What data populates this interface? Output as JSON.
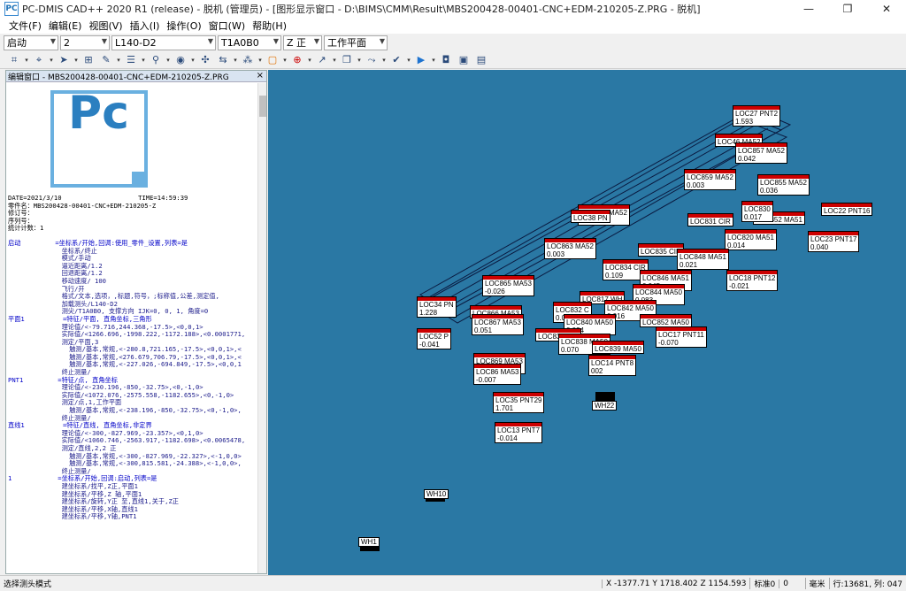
{
  "window": {
    "title": "PC-DMIS CAD++ 2020 R1 (release) - 脱机 (管理员) - [图形显示窗口 - D:\\BIMS\\CMM\\Result\\MBS200428-00401-CNC+EDM-210205-Z.PRG - 脱机]",
    "min": "—",
    "max": "❐",
    "close": "✕"
  },
  "menu": [
    "文件(F)",
    "编辑(E)",
    "视图(V)",
    "插入(I)",
    "操作(O)",
    "窗口(W)",
    "帮助(H)"
  ],
  "combos": [
    {
      "name": "alignment",
      "value": "启动",
      "w": 62
    },
    {
      "name": "probe-num",
      "value": "2",
      "w": 56
    },
    {
      "name": "probe",
      "value": "L140-D2",
      "w": 118
    },
    {
      "name": "tip",
      "value": "T1A0B0",
      "w": 72
    },
    {
      "name": "axis",
      "value": "Z 正",
      "w": 44
    },
    {
      "name": "workplane",
      "value": "工作平面",
      "w": 72
    }
  ],
  "editor": {
    "title": "编辑窗口 - MBS200428-00401-CNC+EDM-210205-Z.PRG",
    "logo": "Pc",
    "close": "×",
    "header": [
      "DATE=2021/3/10                    TIME=14:59:39",
      "零件名：MBS200428-00401-CNC+EDM-210205-Z",
      "修订号：",
      "序列号：",
      "统计计数：1"
    ],
    "lines": [
      "启动         =坐标系/开始,回调:使用_零件_设置,列表=是",
      "              坐标系/终止",
      "              模式/手动",
      "              逼近距离/1.2",
      "              回退距离/1.2",
      "              移动速度/ 100",
      "              飞行/开",
      "              格式/文本,选项，,标题,符号，;标称值,公差,测定值,",
      "              加载测头/L140-D2",
      "              测尖/T1A0B0, 支撑方向 IJK=0, 0, 1, 角度=0",
      "平面1          =特征/平面, 直角坐标,三角形",
      "              理论值/<-79.716,244.368,-17.5>,<0,0,1>",
      "              实际值/<1266.696,-1998.222,-1172.188>,<0.0001771,",
      "              测定/平面,3",
      "                触测/基本,常规,<-280.8,721.165,-17.5>,<0,0,1>,<",
      "                触测/基本,常规,<276.679,706.79,-17.5>,<0,0,1>,<",
      "                触测/基本,常规,<-227.026,-694.849,-17.5>,<0,0,1",
      "              终止测量/",
      "PNT1         =特征/点, 直角坐标",
      "              理论值/<-230.196,-850,-32.75>,<0,-1,0>",
      "              实际值/<1072.076,-2575.558,-1182.655>,<0,-1,0>",
      "              测定/点,1,工作平面",
      "                触测/基本,常规,<-238.196,-850,-32.75>,<0,-1,0>,",
      "              终止测量/",
      "直线1          =特征/直线, 直角坐标,非定界",
      "              理论值/<-300,-827.969,-23.357>,<0,1,0>",
      "              实际值/<1060.746,-2563.917,-1182.698>,<0.0065478,",
      "              测定/直线,2,2 正",
      "                触测/基本,常规,<-300,-827.969,-22.327>,<-1,0,0>",
      "                触测/基本,常规,<-300,815.581,-24.388>,<-1,0,0>,",
      "              终止测量/",
      "1            =坐标系/开始,回调:启动,列表=是",
      "              建坐标系/找平,Z正,平面1",
      "              建坐标系/平移,Z 轴,平面1",
      "              建坐标系/旋转,Y正 至,直线1,关于,Z正",
      "              建坐标系/平移,X轴,直线1",
      "              建坐标系/平移,Y轴,PNT1"
    ]
  },
  "labels": [
    {
      "t": "LOC27 PNT2",
      "v": "1.593"
    },
    {
      "t": "LOC46 MA52",
      "v": ""
    },
    {
      "t": "LOC857 MA52",
      "v": "0.042"
    },
    {
      "t": "LOC855 MA52",
      "v": "0.036"
    },
    {
      "t": "LOC859 MA52",
      "v": "0.003"
    },
    {
      "t": "LOC861 MA52",
      "v": "0.016"
    },
    {
      "t": "LOC22 PNT16",
      "v": ""
    },
    {
      "t": "LOC852 MA51",
      "v": ""
    },
    {
      "t": "LOC830",
      "v": "0.017"
    },
    {
      "t": "LOC38 PN",
      "v": ""
    },
    {
      "t": "LOC831 CIR",
      "v": ""
    },
    {
      "t": "LOC820 MA51",
      "v": "0.014"
    },
    {
      "t": "LOC23 PNT17",
      "v": "0.040"
    },
    {
      "t": "LOC863 MA52",
      "v": "0.003"
    },
    {
      "t": "LOC835 CIR",
      "v": ""
    },
    {
      "t": "LOC848 MA51",
      "v": "0.021"
    },
    {
      "t": "LOC834 CIR",
      "v": "0.109"
    },
    {
      "t": "LOC846 MA51",
      "v": "0.045"
    },
    {
      "t": "LOC18 PNT12",
      "v": "-0.021"
    },
    {
      "t": "LOC865 MA53",
      "v": "-0.026"
    },
    {
      "t": "LOC844 MA50",
      "v": "0.083"
    },
    {
      "t": "LOC817 WH",
      "v": ""
    },
    {
      "t": "LOC832 C",
      "v": "0.065"
    },
    {
      "t": "LOC842 MA50",
      "v": "0.016"
    },
    {
      "t": "LOC34 PN",
      "v": "1.228"
    },
    {
      "t": "LOC866 MA53",
      "v": ""
    },
    {
      "t": "LOC867 MA53",
      "v": "0.051"
    },
    {
      "t": "LOC840 MA50",
      "v": "0.034"
    },
    {
      "t": "LOC852 MA50",
      "v": ""
    },
    {
      "t": "LOC17 PNT11",
      "v": "-0.070"
    },
    {
      "t": "LOC52 P",
      "v": "-0.041"
    },
    {
      "t": "LOC833 CIR",
      "v": ""
    },
    {
      "t": "LOC838 MA50",
      "v": "0.070"
    },
    {
      "t": "LOC839 MA50",
      "v": ""
    },
    {
      "t": "LOC869 MA53",
      "v": "0.050"
    },
    {
      "t": "LOC14 PNT8",
      "v": "002"
    },
    {
      "t": "LOC86 MA53",
      "v": "-0.007"
    },
    {
      "t": "LOC35 PNT29",
      "v": "1.701"
    },
    {
      "t": "WH22",
      "v": ""
    },
    {
      "t": "LOC13 PNT7",
      "v": "-0.014"
    },
    {
      "t": "WH10",
      "v": ""
    },
    {
      "t": "WH1",
      "v": ""
    }
  ],
  "status": {
    "mode": "选择测头模式",
    "coords": "X -1377.71  Y 1718.402  Z 1154.593",
    "state": "标准0",
    "zero": "0",
    "unit": "毫米",
    "linecol": "行:13681, 列: 047"
  }
}
